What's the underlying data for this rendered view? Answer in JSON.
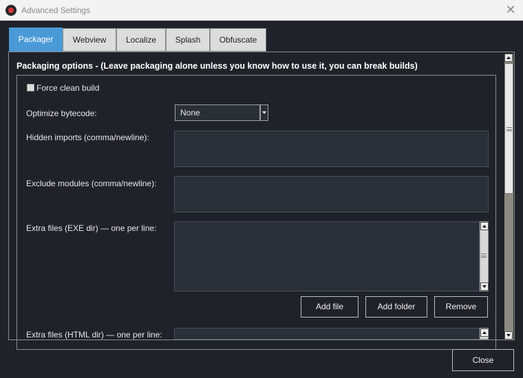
{
  "window": {
    "title": "Advanced Settings"
  },
  "tabs": [
    {
      "label": "Packager",
      "active": true
    },
    {
      "label": "Webview",
      "active": false
    },
    {
      "label": "Localize",
      "active": false
    },
    {
      "label": "Splash",
      "active": false
    },
    {
      "label": "Obfuscate",
      "active": false
    }
  ],
  "section": {
    "title": "Packaging options - (Leave packaging alone unless you know how to use it, you can break builds)"
  },
  "fields": {
    "force_clean": {
      "label": "Force clean build",
      "checked": false
    },
    "optimize": {
      "label": "Optimize bytecode:",
      "value": "None"
    },
    "hidden_imports": {
      "label": "Hidden imports (comma/newline):",
      "value": ""
    },
    "exclude_modules": {
      "label": "Exclude modules (comma/newline):",
      "value": ""
    },
    "extra_exe": {
      "label": "Extra files (EXE dir) — one per line:",
      "value": ""
    },
    "extra_html": {
      "label": "Extra files (HTML dir) — one per line:",
      "value": ""
    }
  },
  "buttons": {
    "add_file": "Add file",
    "add_folder": "Add folder",
    "remove": "Remove",
    "close": "Close"
  },
  "icons": {
    "app": "app-logo-icon",
    "close": "close-icon"
  }
}
